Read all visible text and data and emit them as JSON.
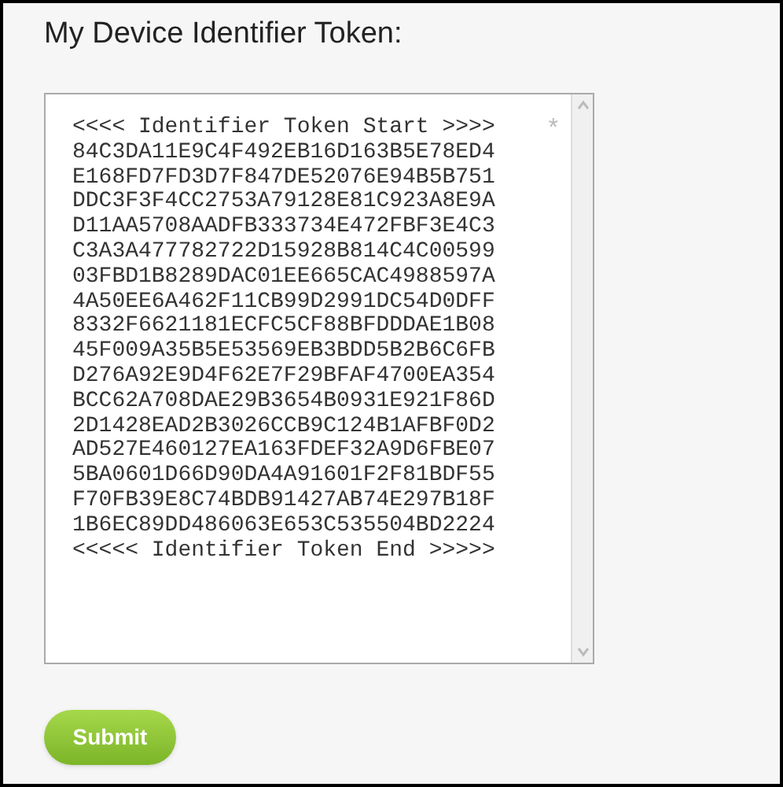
{
  "heading": "My Device Identifier Token:",
  "token_field": {
    "marker": "*",
    "lines": [
      "<<<< Identifier Token Start >>>>",
      "84C3DA11E9C4F492EB16D163B5E78ED4",
      "E168FD7FD3D7F847DE52076E94B5B751",
      "DDC3F3F4CC2753A79128E81C923A8E9A",
      "D11AA5708AADFB333734E472FBF3E4C3",
      "C3A3A477782722D15928B814C4C00599",
      "03FBD1B8289DAC01EE665CAC4988597A",
      "4A50EE6A462F11CB99D2991DC54D0DFF",
      "8332F6621181ECFC5CF88BFDDDAE1B08",
      "45F009A35B5E53569EB3BDD5B2B6C6FB",
      "D276A92E9D4F62E7F29BFAF4700EA354",
      "BCC62A708DAE29B3654B0931E921F86D",
      "2D1428EAD2B3026CCB9C124B1AFBF0D2",
      "AD527E460127EA163FDEF32A9D6FBE07",
      "5BA0601D66D90DA4A91601F2F81BDF55",
      "F70FB39E8C74BDB91427AB74E297B18F",
      "1B6EC89DD486063E653C535504BD2224",
      "<<<<< Identifier Token End >>>>>"
    ]
  },
  "submit_button": "Submit"
}
